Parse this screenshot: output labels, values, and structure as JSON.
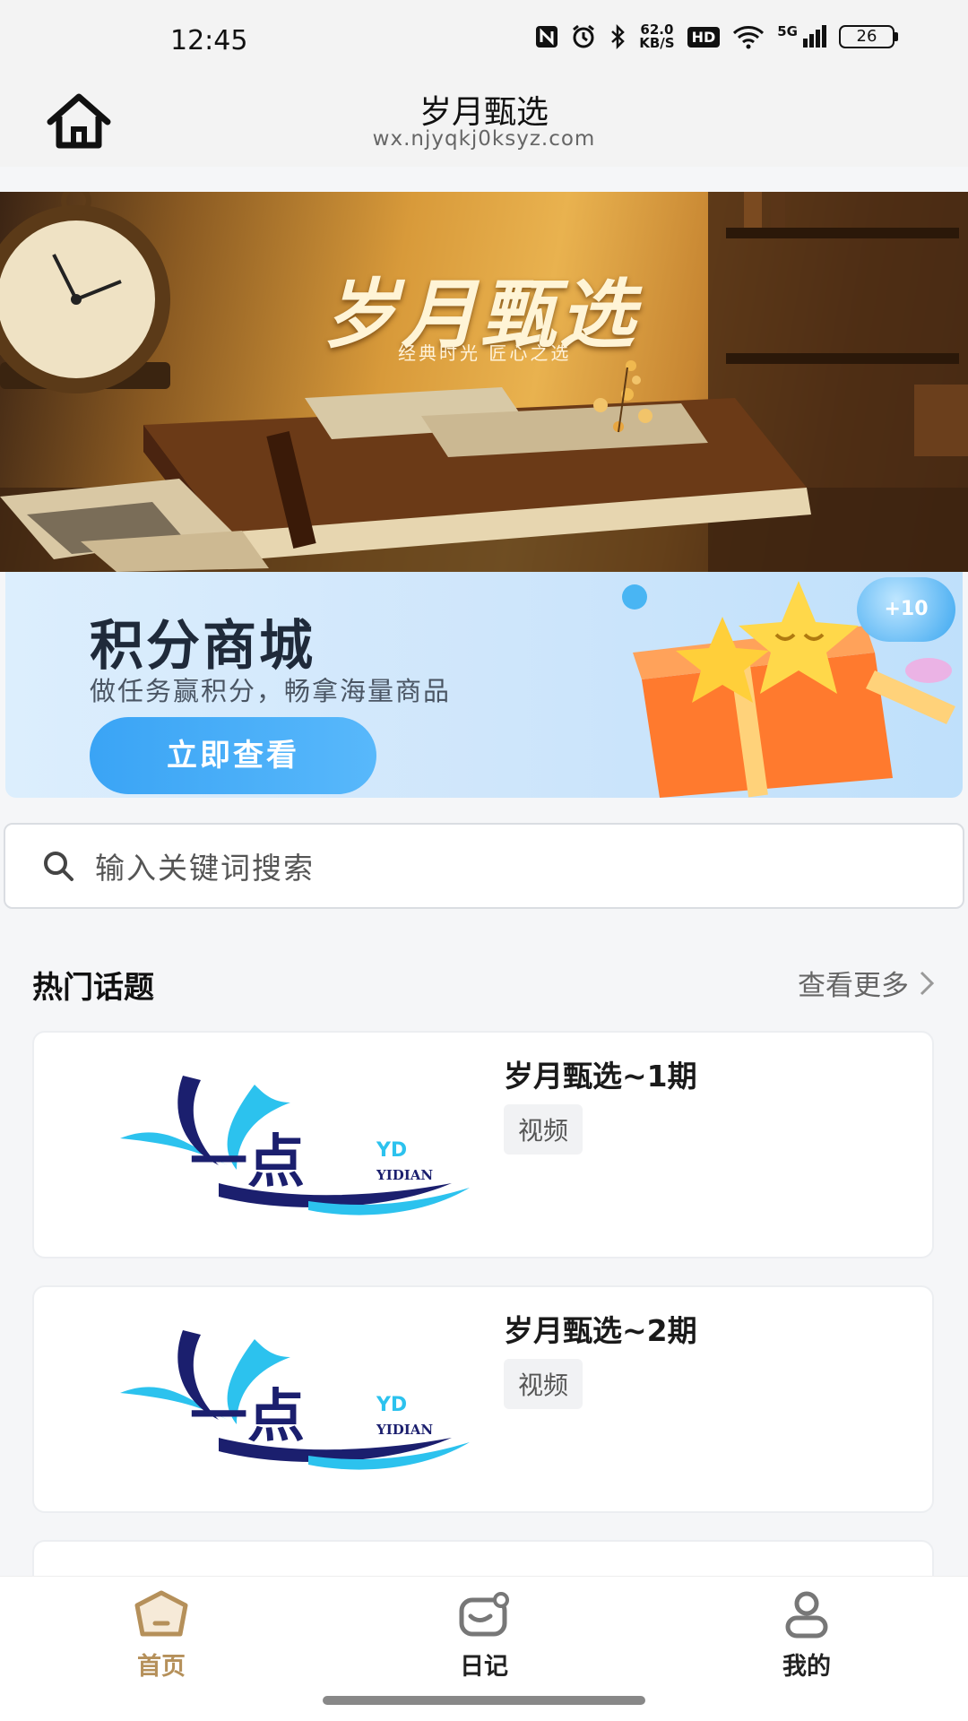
{
  "status_bar": {
    "time": "12:45",
    "speed_value": "62.0",
    "speed_unit": "KB/S",
    "hd": "HD",
    "network": "5G",
    "battery": "26",
    "icons": [
      "nfc-icon",
      "alarm-icon",
      "bluetooth-icon",
      "wifi-icon",
      "signal-icon",
      "battery-icon"
    ]
  },
  "nav": {
    "title": "岁月甄选",
    "url": "wx.njyqkj0ksyz.com"
  },
  "hero": {
    "title": "岁月甄选",
    "subtitle": "经典时光 匠心之选"
  },
  "mall_banner": {
    "title": "积分商城",
    "subtitle": "做任务赢积分，畅拿海量商品",
    "button": "立即查看",
    "points_badge": "+10"
  },
  "search": {
    "placeholder": "输入关键词搜索"
  },
  "hot_topics": {
    "title": "热门话题",
    "more": "查看更多",
    "items": [
      {
        "title": "岁月甄选~1期",
        "tag": "视频",
        "logo_text": "一点",
        "logo_en": "YIDIAN",
        "logo_badge": "YD"
      },
      {
        "title": "岁月甄选~2期",
        "tag": "视频",
        "logo_text": "一点",
        "logo_en": "YIDIAN",
        "logo_badge": "YD"
      }
    ]
  },
  "tabs": [
    {
      "label": "首页",
      "icon": "home-icon",
      "active": true
    },
    {
      "label": "日记",
      "icon": "diary-icon",
      "active": false
    },
    {
      "label": "我的",
      "icon": "user-icon",
      "active": false
    }
  ],
  "colors": {
    "accent": "#b5905a",
    "mall_button": "#3aa4f5",
    "logo_dark": "#1b1f6e",
    "logo_light": "#2cc2ee"
  }
}
